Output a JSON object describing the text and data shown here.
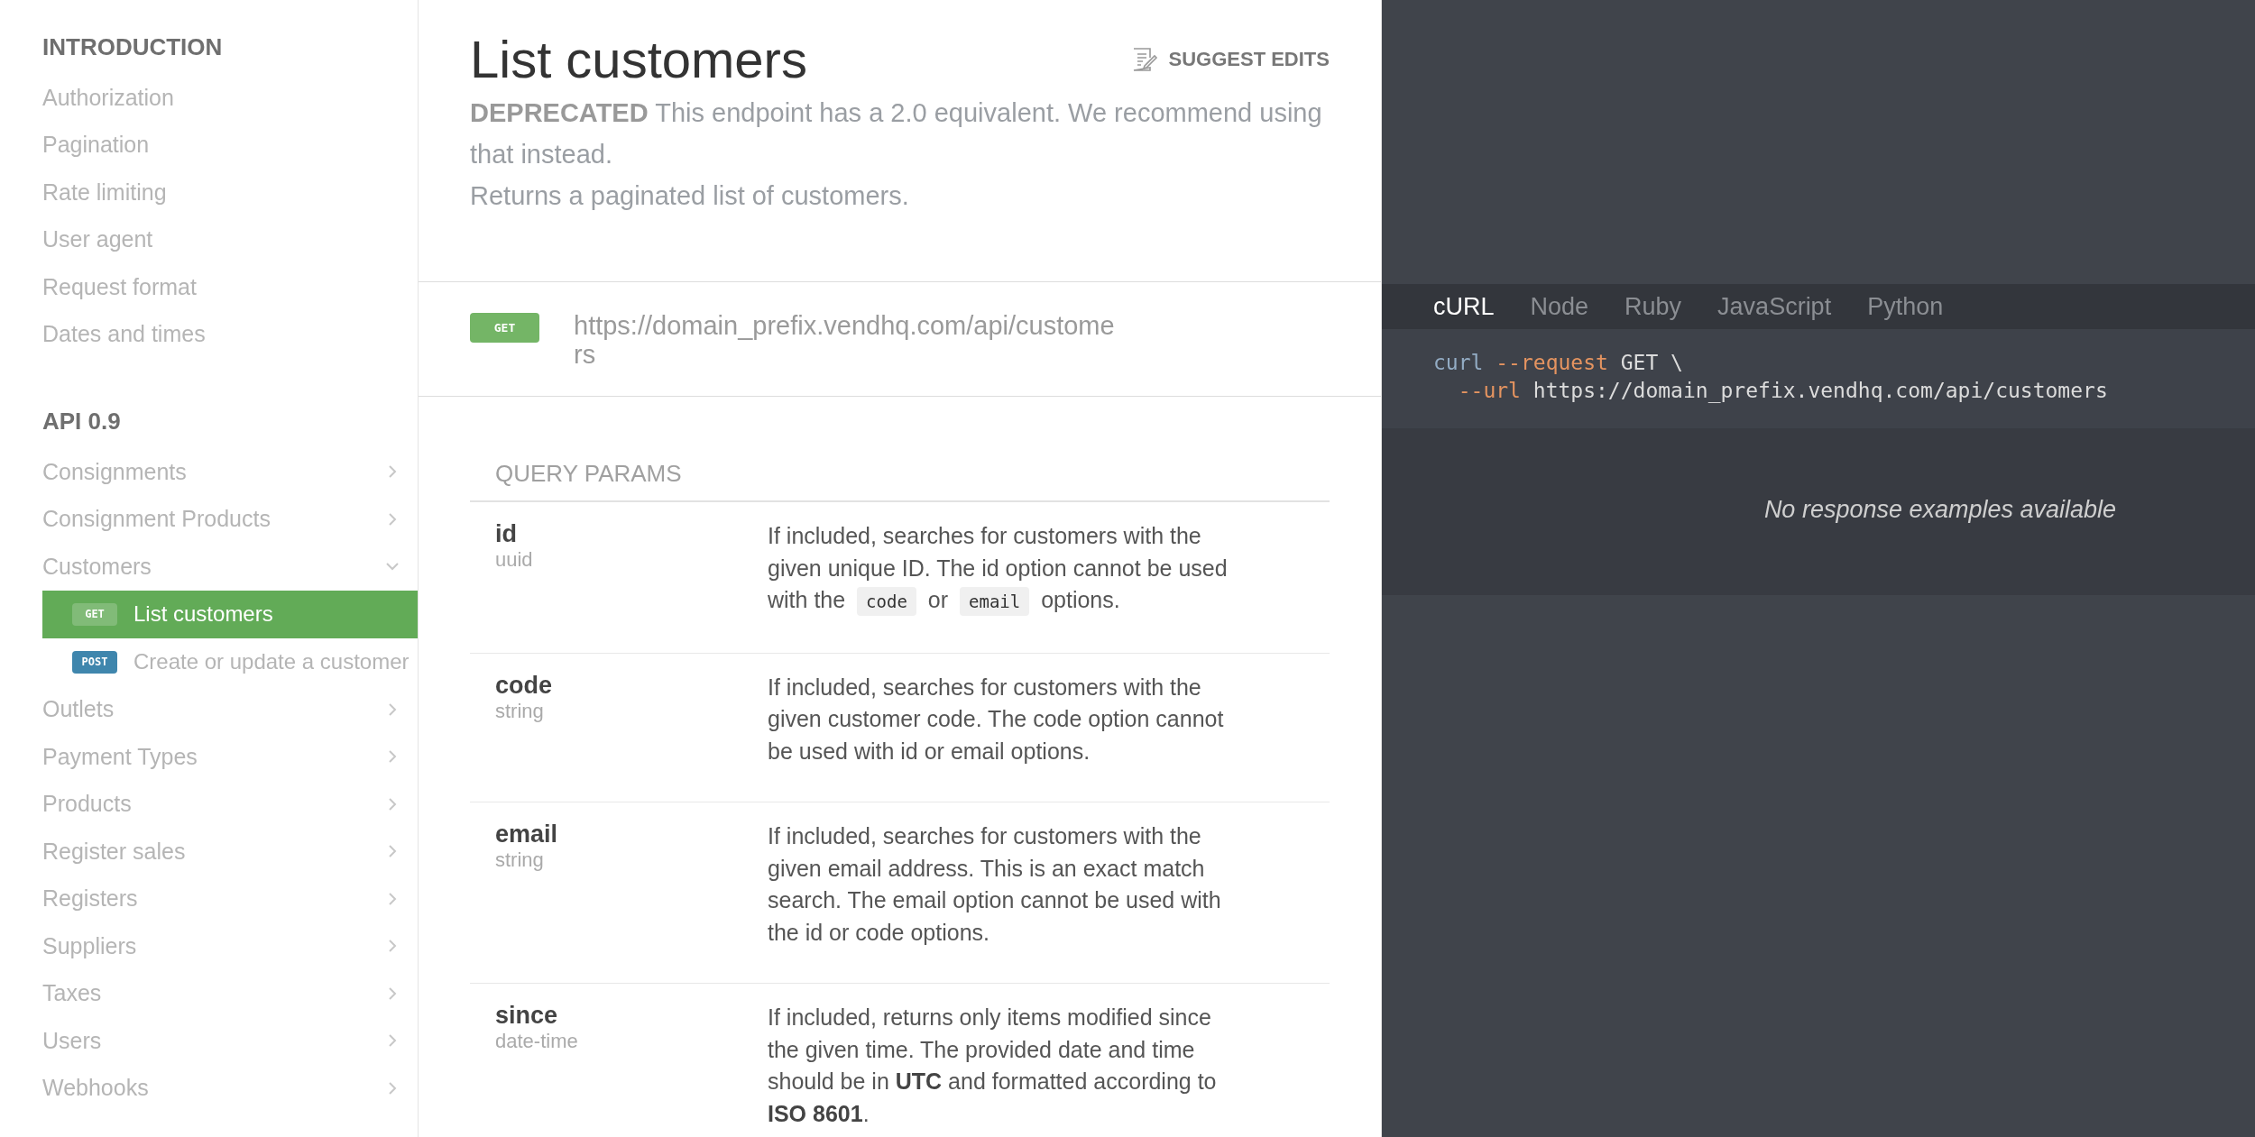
{
  "sidebar": {
    "sections": [
      {
        "title": "INTRODUCTION",
        "items": [
          {
            "kind": "link",
            "label": "Authorization"
          },
          {
            "kind": "link",
            "label": "Pagination"
          },
          {
            "kind": "link",
            "label": "Rate limiting"
          },
          {
            "kind": "link",
            "label": "User agent"
          },
          {
            "kind": "link",
            "label": "Request format"
          },
          {
            "kind": "link",
            "label": "Dates and times"
          }
        ]
      },
      {
        "title": "API 0.9",
        "items": [
          {
            "kind": "group",
            "label": "Consignments",
            "expanded": false
          },
          {
            "kind": "group",
            "label": "Consignment Products",
            "expanded": false
          },
          {
            "kind": "group",
            "label": "Customers",
            "expanded": true,
            "children": [
              {
                "method": "GET",
                "label": "List customers",
                "selected": true
              },
              {
                "method": "POST",
                "label": "Create or update a customer",
                "selected": false
              }
            ]
          },
          {
            "kind": "group",
            "label": "Outlets",
            "expanded": false
          },
          {
            "kind": "group",
            "label": "Payment Types",
            "expanded": false
          },
          {
            "kind": "group",
            "label": "Products",
            "expanded": false
          },
          {
            "kind": "group",
            "label": "Register sales",
            "expanded": false
          },
          {
            "kind": "group",
            "label": "Registers",
            "expanded": false
          },
          {
            "kind": "group",
            "label": "Suppliers",
            "expanded": false
          },
          {
            "kind": "group",
            "label": "Taxes",
            "expanded": false
          },
          {
            "kind": "group",
            "label": "Users",
            "expanded": false
          },
          {
            "kind": "group",
            "label": "Webhooks",
            "expanded": false
          }
        ]
      }
    ]
  },
  "page": {
    "title": "List customers",
    "suggest_edits": "SUGGEST EDITS",
    "description": [
      "**DEPRECATED** This endpoint has a 2.0 equivalent. We recommend using that instead.",
      "Returns a paginated list of customers."
    ],
    "endpoint": {
      "method": "GET",
      "url": "https://domain_prefix.vendhq.com/api/customers"
    },
    "query_params": {
      "title": "QUERY PARAMS",
      "params": [
        {
          "name": "id",
          "type": "uuid",
          "description": [
            {
              "kind": "text",
              "text": "If included, searches for customers with the given unique ID. The id option cannot be used with the "
            },
            {
              "kind": "code",
              "text": "code"
            },
            {
              "kind": "text",
              "text": " or "
            },
            {
              "kind": "code",
              "text": "email"
            },
            {
              "kind": "text",
              "text": " options."
            }
          ]
        },
        {
          "name": "code",
          "type": "string",
          "description": [
            {
              "kind": "text",
              "text": "If included, searches for customers with the given customer code. The code option cannot be used with id or email options."
            }
          ]
        },
        {
          "name": "email",
          "type": "string",
          "description": [
            {
              "kind": "text",
              "text": "If included, searches for customers with the given email address. This is an exact match search. The email option cannot be used with the id or code options."
            }
          ]
        },
        {
          "name": "since",
          "type": "date-time",
          "description": [
            {
              "kind": "text",
              "text": "If included, returns only items modified since the given time. The provided date and time should be in **UTC** and formatted according to **ISO 8601**."
            }
          ]
        }
      ]
    }
  },
  "code_panel": {
    "tabs": [
      {
        "label": "cURL",
        "selected": true
      },
      {
        "label": "Node",
        "selected": false
      },
      {
        "label": "Ruby",
        "selected": false
      },
      {
        "label": "JavaScript",
        "selected": false
      },
      {
        "label": "Python",
        "selected": false
      }
    ],
    "lines": [
      [
        {
          "kind": "command",
          "text": "curl"
        },
        {
          "kind": "flag",
          "text": " --request"
        },
        {
          "kind": "plain",
          "text": " GET \\"
        }
      ],
      [
        {
          "kind": "flag",
          "text": "  --url"
        },
        {
          "kind": "plain",
          "text": " https://domain_prefix.vendhq.com/api/customers"
        }
      ]
    ],
    "response_message": "No response examples available"
  }
}
